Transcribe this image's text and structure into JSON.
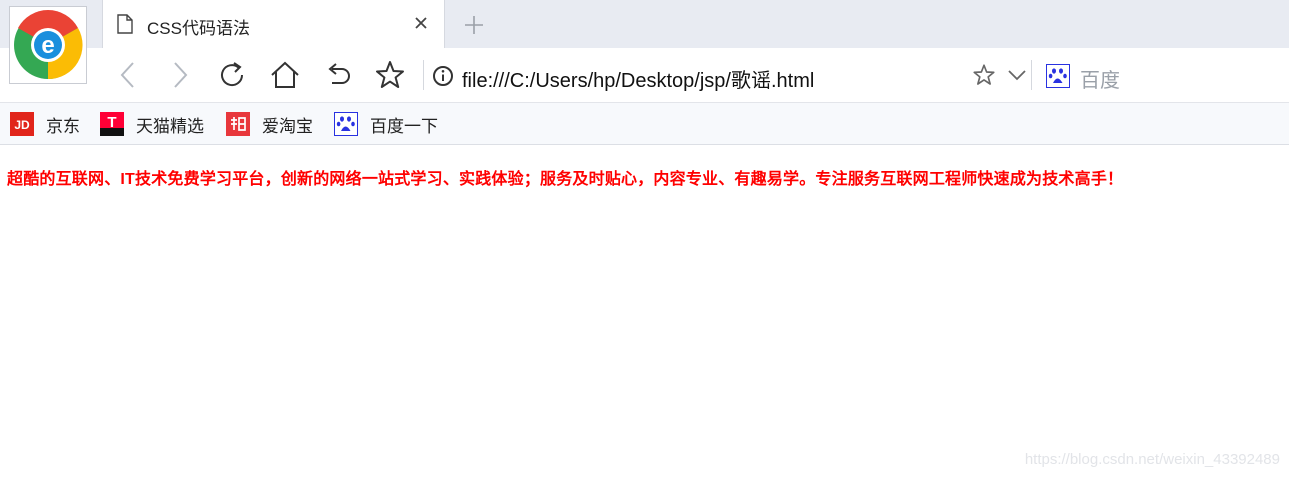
{
  "browser": {
    "tab": {
      "title": "CSS代码语法"
    },
    "address_bar": {
      "url": "file:///C:/Users/hp/Desktop/jsp/歌谣.html"
    },
    "search": {
      "engine_label": "百度"
    },
    "bookmarks": [
      {
        "label": "京东",
        "icon": "jd-icon",
        "color": "#e1251b"
      },
      {
        "label": "天猫精选",
        "icon": "tmall-icon",
        "color": "#ff0036"
      },
      {
        "label": "爱淘宝",
        "icon": "taobao-icon",
        "color": "#ff4400"
      },
      {
        "label": "百度一下",
        "icon": "baidu-paw-icon",
        "color": "#2932e1"
      }
    ]
  },
  "page": {
    "text": "超酷的互联网、IT技术免费学习平台，创新的网络一站式学习、实践体验；服务及时贴心，内容专业、有趣易学。专注服务互联网工程师快速成为技术高手！",
    "text_color": "#ff0000"
  },
  "watermark": "https://blog.csdn.net/weixin_43392489"
}
